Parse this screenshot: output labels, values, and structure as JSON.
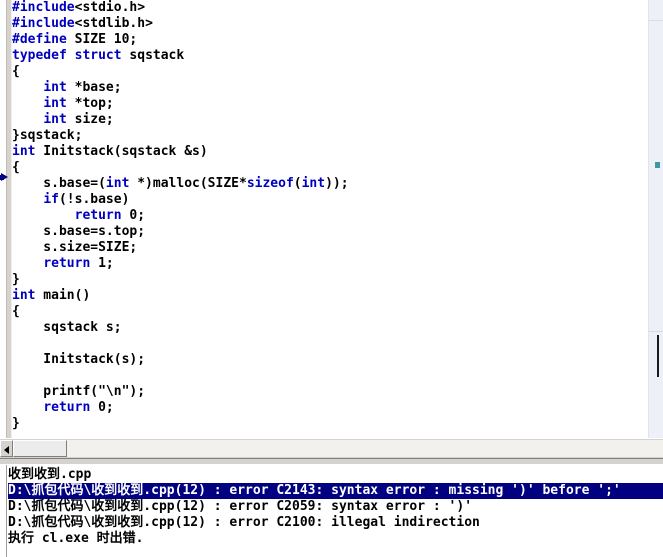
{
  "editor": {
    "marker": "execution-arrow",
    "lines": [
      [
        {
          "t": "#include",
          "c": "pp"
        },
        {
          "t": "<stdio.h>",
          "c": "pl"
        }
      ],
      [
        {
          "t": "#include",
          "c": "pp"
        },
        {
          "t": "<stdlib.h>",
          "c": "pl"
        }
      ],
      [
        {
          "t": "#define",
          "c": "pp"
        },
        {
          "t": " SIZE 10;",
          "c": "pl"
        }
      ],
      [
        {
          "t": "typedef",
          "c": "kw"
        },
        {
          "t": " ",
          "c": "pl"
        },
        {
          "t": "struct",
          "c": "kw"
        },
        {
          "t": " sqstack",
          "c": "pl"
        }
      ],
      [
        {
          "t": "{",
          "c": "pl"
        }
      ],
      [
        {
          "t": "    ",
          "c": "pl"
        },
        {
          "t": "int",
          "c": "kw"
        },
        {
          "t": " *base;",
          "c": "pl"
        }
      ],
      [
        {
          "t": "    ",
          "c": "pl"
        },
        {
          "t": "int",
          "c": "kw"
        },
        {
          "t": " *top;",
          "c": "pl"
        }
      ],
      [
        {
          "t": "    ",
          "c": "pl"
        },
        {
          "t": "int",
          "c": "kw"
        },
        {
          "t": " size;",
          "c": "pl"
        }
      ],
      [
        {
          "t": "}sqstack;",
          "c": "pl"
        }
      ],
      [
        {
          "t": "int",
          "c": "kw"
        },
        {
          "t": " Initstack(sqstack &s)",
          "c": "pl"
        }
      ],
      [
        {
          "t": "{",
          "c": "pl"
        }
      ],
      [
        {
          "t": "    s.base=(",
          "c": "pl"
        },
        {
          "t": "int",
          "c": "kw"
        },
        {
          "t": " *)malloc(SIZE*",
          "c": "pl"
        },
        {
          "t": "sizeof",
          "c": "kw"
        },
        {
          "t": "(",
          "c": "pl"
        },
        {
          "t": "int",
          "c": "kw"
        },
        {
          "t": "));",
          "c": "pl"
        }
      ],
      [
        {
          "t": "    ",
          "c": "pl"
        },
        {
          "t": "if",
          "c": "kw"
        },
        {
          "t": "(!s.base)",
          "c": "pl"
        }
      ],
      [
        {
          "t": "        ",
          "c": "pl"
        },
        {
          "t": "return",
          "c": "kw"
        },
        {
          "t": " 0;",
          "c": "pl"
        }
      ],
      [
        {
          "t": "    s.base=s.top;",
          "c": "pl"
        }
      ],
      [
        {
          "t": "    s.size=SIZE;",
          "c": "pl"
        }
      ],
      [
        {
          "t": "    ",
          "c": "pl"
        },
        {
          "t": "return",
          "c": "kw"
        },
        {
          "t": " 1;",
          "c": "pl"
        }
      ],
      [
        {
          "t": "}",
          "c": "pl"
        }
      ],
      [
        {
          "t": "int",
          "c": "kw"
        },
        {
          "t": " main()",
          "c": "pl"
        }
      ],
      [
        {
          "t": "{",
          "c": "pl"
        }
      ],
      [
        {
          "t": "    sqstack s;",
          "c": "pl"
        }
      ],
      [],
      [
        {
          "t": "    Initstack(s);",
          "c": "pl"
        }
      ],
      [],
      [
        {
          "t": "    printf(\"\\n\");",
          "c": "pl"
        }
      ],
      [
        {
          "t": "    ",
          "c": "pl"
        },
        {
          "t": "return",
          "c": "kw"
        },
        {
          "t": " 0;",
          "c": "pl"
        }
      ],
      [
        {
          "t": "}",
          "c": "pl"
        }
      ]
    ]
  },
  "scrollbar": {
    "left_arrow": "◄"
  },
  "output": {
    "lines": [
      {
        "text": "收到收到.cpp",
        "selected": false
      },
      {
        "text": "D:\\抓包代码\\收到收到.cpp(12) : error C2143: syntax error : missing ')' before ';'",
        "selected": true
      },
      {
        "text": "D:\\抓包代码\\收到收到.cpp(12) : error C2059: syntax error : ')'",
        "selected": false
      },
      {
        "text": "D:\\抓包代码\\收到收到.cpp(12) : error C2100: illegal indirection",
        "selected": false
      },
      {
        "text": "执行 cl.exe 时出错.",
        "selected": false
      }
    ]
  },
  "colors": {
    "keyword": "#0000c0",
    "text": "#000000",
    "selection_bg": "#000080",
    "selection_fg": "#ffffff",
    "chrome": "#d6d3ce",
    "marker": "#000080"
  }
}
